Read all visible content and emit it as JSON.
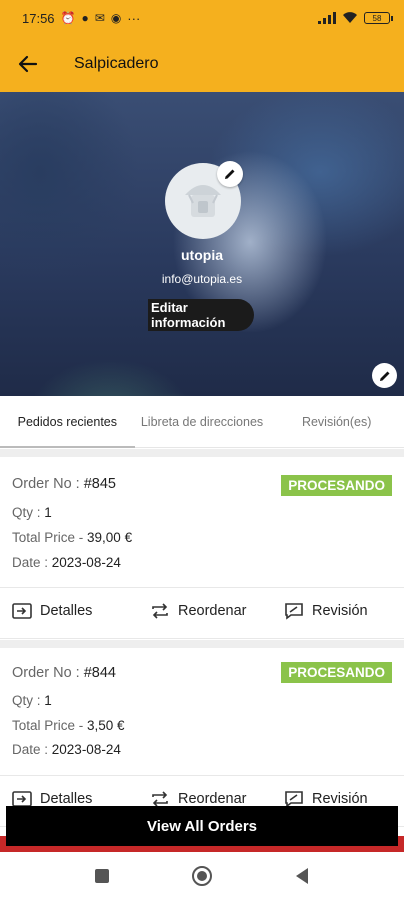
{
  "status_bar": {
    "time": "17:56",
    "notification_icons": [
      "alarm-icon",
      "vpn-icon",
      "mail-icon",
      "messenger-icon"
    ],
    "more": "···",
    "signal": "signal-icon",
    "wifi": "wifi-icon",
    "battery": "58"
  },
  "app_bar": {
    "title": "Salpicadero",
    "back_icon": "arrow-left-icon",
    "color": "#f5b01e"
  },
  "profile": {
    "name": "utopia",
    "email": "info@utopia.es",
    "edit_button_line1": "Editar",
    "edit_button_line2": "información"
  },
  "tabs": [
    {
      "label": "Pedidos recientes",
      "active": true
    },
    {
      "label": "Libreta de direcciones",
      "active": false
    },
    {
      "label": "Revisión(es)",
      "active": false
    }
  ],
  "orders": [
    {
      "order_no_label": "Order No : ",
      "order_no": "#845",
      "status": "PROCESANDO",
      "qty_label": "Qty : ",
      "qty": "1",
      "price_label": "Total Price - ",
      "price": "39,00 €",
      "date_label": "Date : ",
      "date": "2023-08-24"
    },
    {
      "order_no_label": "Order No : ",
      "order_no": "#844",
      "status": "PROCESANDO",
      "qty_label": "Qty : ",
      "qty": "1",
      "price_label": "Total Price - ",
      "price": "3,50 €",
      "date_label": "Date : ",
      "date": "2023-08-24"
    }
  ],
  "actions": {
    "details": "Detalles",
    "reorder": "Reordenar",
    "review": "Revisión"
  },
  "view_all": "View All Orders",
  "colors": {
    "accent": "#f5b01e",
    "status_green": "#8bc34a",
    "strip_red": "#c62828"
  }
}
